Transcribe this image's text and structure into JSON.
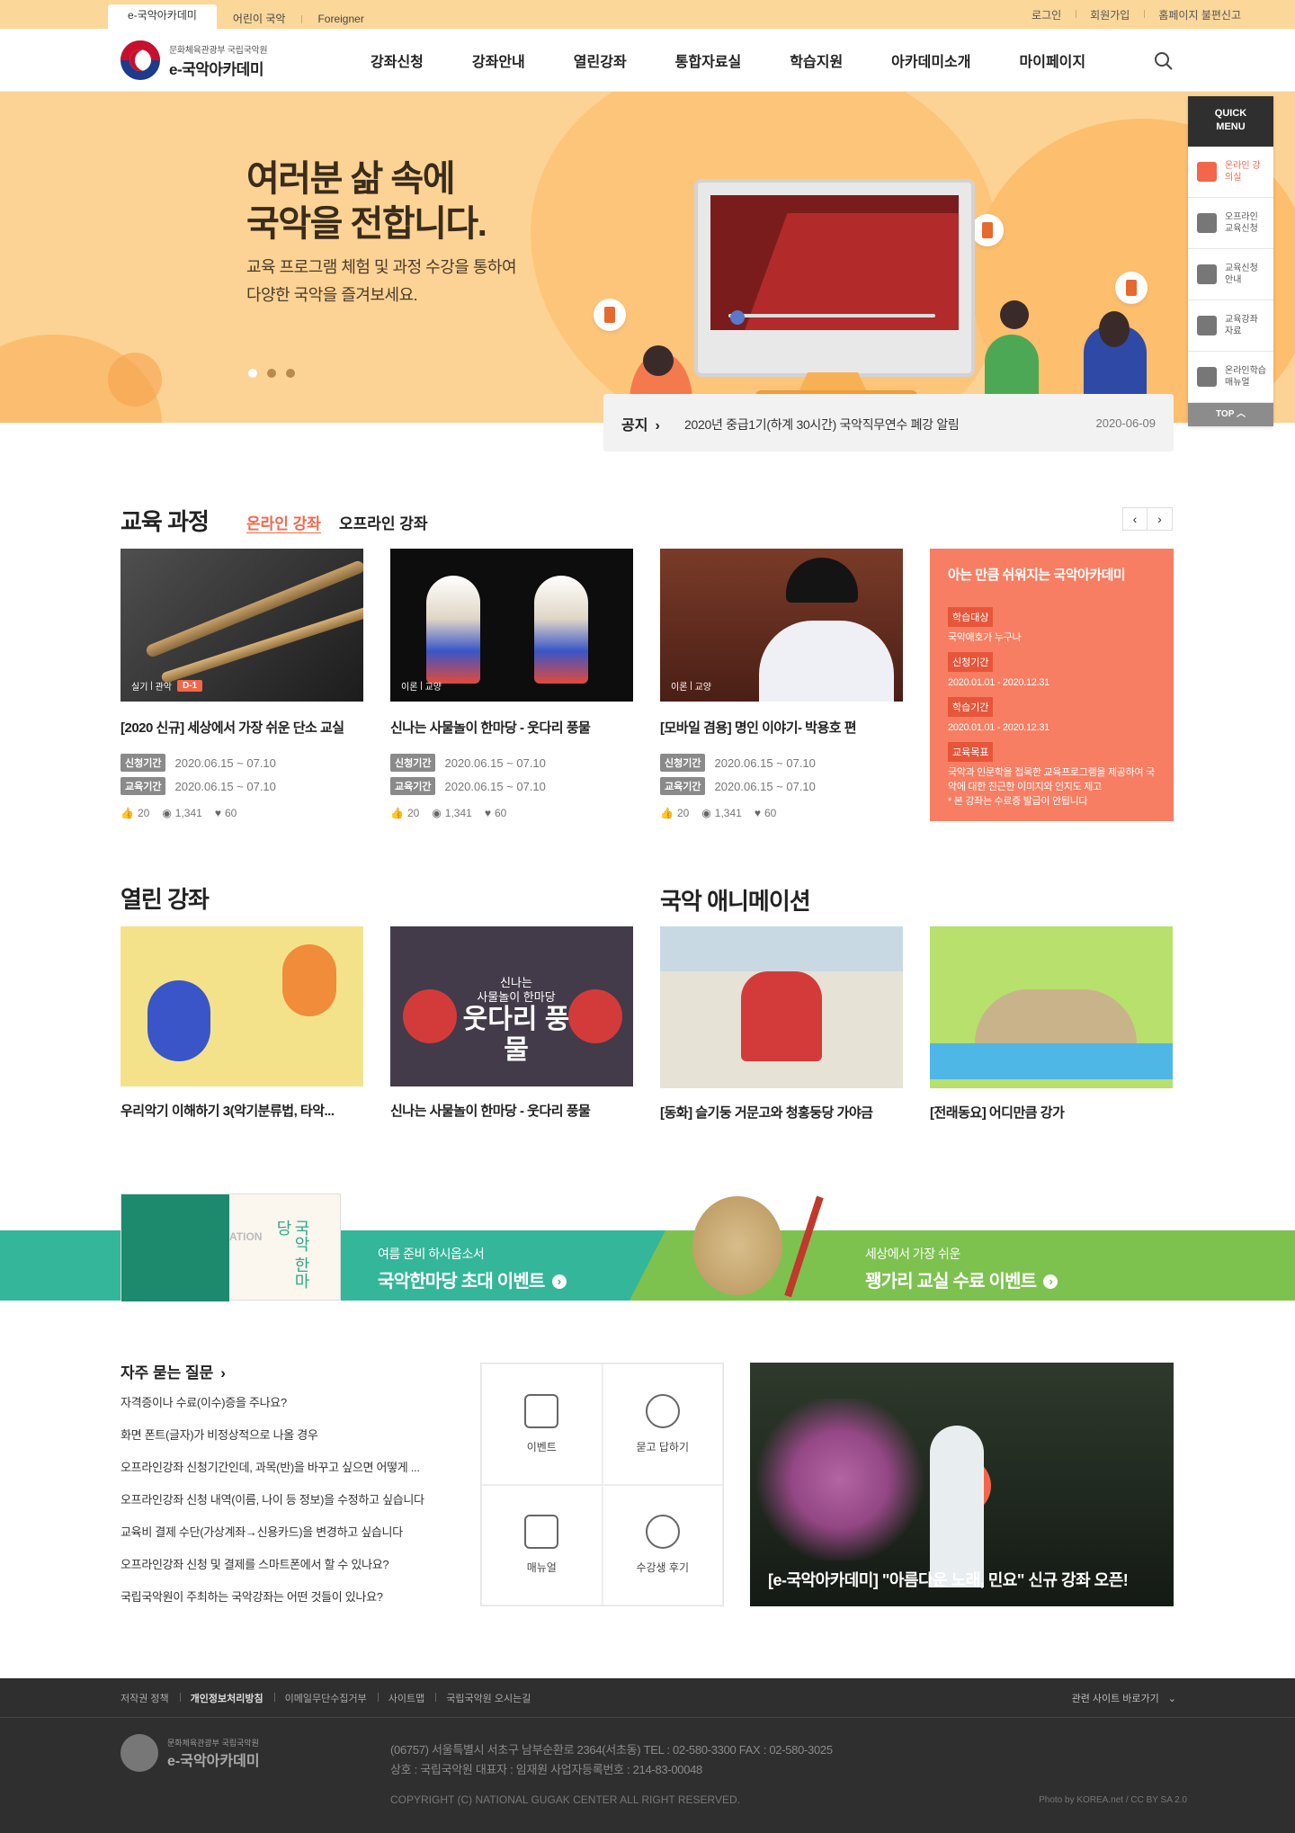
{
  "util": {
    "tabs": [
      "e-국악아카데미",
      "어린이 국악",
      "Foreigner"
    ],
    "links": [
      "로그인",
      "회원가입",
      "홈페이지 불편신고"
    ]
  },
  "header": {
    "logo_small": "문화체육관광부 국립국악원",
    "logo_big": "e-국악아카데미",
    "nav": [
      "강좌신청",
      "강좌안내",
      "열린강좌",
      "통합자료실",
      "학습지원",
      "아카데미소개",
      "마이페이지"
    ]
  },
  "hero": {
    "title_line1": "여러분 삶 속에",
    "title_line2": "국악을 전합니다.",
    "desc_line1": "교육 프로그램 체험 및 과정 수강을 통하여",
    "desc_line2": "다양한 국악을 즐겨보세요."
  },
  "notice": {
    "label": "공지",
    "title": "2020년 중급1기(하계 30시간) 국악직무연수 폐강 알림",
    "date": "2020-06-09"
  },
  "quick": {
    "title_line1": "QUICK",
    "title_line2": "MENU",
    "items": [
      "온라인 강의실",
      "오프라인 교육신청",
      "교육신청 안내",
      "교육강좌 자료",
      "온라인학습 매뉴얼"
    ],
    "top": "TOP"
  },
  "edu": {
    "title": "교육 과정",
    "tab_online": "온라인 강좌",
    "tab_offline": "오프라인 강좌",
    "apply_label": "신청기간",
    "edu_label": "교육기간",
    "cards": [
      {
        "tag1": "실기",
        "tag2": "관악",
        "dday": "D-1",
        "title": "[2020 신규] 세상에서 가장 쉬운 단소 교실",
        "apply": "2020.06.15 ~ 07.10",
        "period": "2020.06.15 ~ 07.10",
        "likes": "20",
        "views": "1,341",
        "hearts": "60"
      },
      {
        "tag1": "이론",
        "tag2": "교양",
        "title": "신나는 사물놀이 한마당 - 웃다리 풍물",
        "apply": "2020.06.15 ~ 07.10",
        "period": "2020.06.15 ~ 07.10",
        "likes": "20",
        "views": "1,341",
        "hearts": "60"
      },
      {
        "tag1": "이론",
        "tag2": "교양",
        "title": "[모바일 겸용] 명인 이야기- 박용호 편",
        "apply": "2020.06.15 ~ 07.10",
        "period": "2020.06.15 ~ 07.10",
        "likes": "20",
        "views": "1,341",
        "hearts": "60"
      }
    ],
    "info": {
      "title": "아는 만큼 쉬워지는 국악아카데미",
      "target_label": "학습대상",
      "target": "국악애호가 누구나",
      "apply_label": "신청기간",
      "apply": "2020.01.01 - 2020.12.31",
      "study_label": "학습기간",
      "study": "2020.01.01 - 2020.12.31",
      "goal_label": "교육목표",
      "goal": "국악과 인문학을 접목한 교육프로그램을 제공하여 국악에 대한 친근한 이미지와 인지도 제고",
      "note": "* 본 강좌는 수료증 발급이 안됩니다"
    }
  },
  "open": {
    "title": "열린 강좌",
    "items": [
      "우리악기 이해하기 3(악기분류법, 타악...",
      "신나는 사물놀이 한마당 - 웃다리 풍물"
    ],
    "thumb_text_small1": "신나는",
    "thumb_text_small2": "사물놀이 한마당",
    "thumb_text_big": "웃다리 풍물"
  },
  "anim": {
    "title": "국악 애니메이션",
    "items": [
      "[동화] 슬기둥 거문고와 청홍둥당 가야금",
      "[전래동요] 어디만큼 강가"
    ]
  },
  "banners": {
    "left_small": "여름 준비 하시옵소서",
    "left_big": "국악한마당 초대 이벤트",
    "right_small": "세상에서 가장 쉬운",
    "right_big": "꽹가리 교실 수료 이벤트",
    "card_text": "국악 한마당",
    "card_word": "ATION"
  },
  "faq": {
    "title": "자주 묻는 질문",
    "items": [
      "자격증이나 수료(이수)증을 주나요?",
      "화면 폰트(글자)가 비정상적으로 나올 경우",
      "오프라인강좌 신청기간인데, 과목(반)을 바꾸고 싶으면 어떻게 ...",
      "오프라인강좌 신청 내역(이름, 나이 등 정보)을 수정하고 싶습니다",
      "교육비 결제 수단(가상계좌→신용카드)을 변경하고 싶습니다",
      "오프라인강좌 신청 및 결제를 스마트폰에서 할 수 있나요?",
      "국립국악원이 주최하는 국악강좌는 어떤 것들이 있나요?"
    ]
  },
  "grid": [
    "이벤트",
    "묻고 답하기",
    "매뉴얼",
    "수강생 후기"
  ],
  "video": {
    "caption": "[e-국악아카데미] \"아름다운 노래, 민요\" 신규 강좌 오픈!"
  },
  "footer": {
    "links": [
      "저작권 정책",
      "개인정보처리방침",
      "이메일무단수집거부",
      "사이트맵",
      "국립국악원 오시는길"
    ],
    "related": "관련 사이트 바로가기",
    "logo_small": "문화체육관광부 국립국악원",
    "logo_big": "e-국악아카데미",
    "addr1": "(06757) 서울특별시 서초구 남부순환로 2364(서초동)   TEL : 02-580-3300   FAX : 02-580-3025",
    "addr2": "상호 : 국립국악원   대표자 : 임재원   사업자등록번호 : 214-83-00048",
    "copyright": "COPYRIGHT (C) NATIONAL GUGAK CENTER ALL RIGHT RESERVED.",
    "photo": "Photo by KOREA.net / CC BY SA 2.0"
  },
  "colors": {
    "accent": "#f4664a",
    "utility_bar": "#fbd79a",
    "hero_bg": "#fcd394",
    "banner_left": "#34b69a",
    "banner_right": "#7dc24f",
    "footer": "#2f2f2f"
  }
}
